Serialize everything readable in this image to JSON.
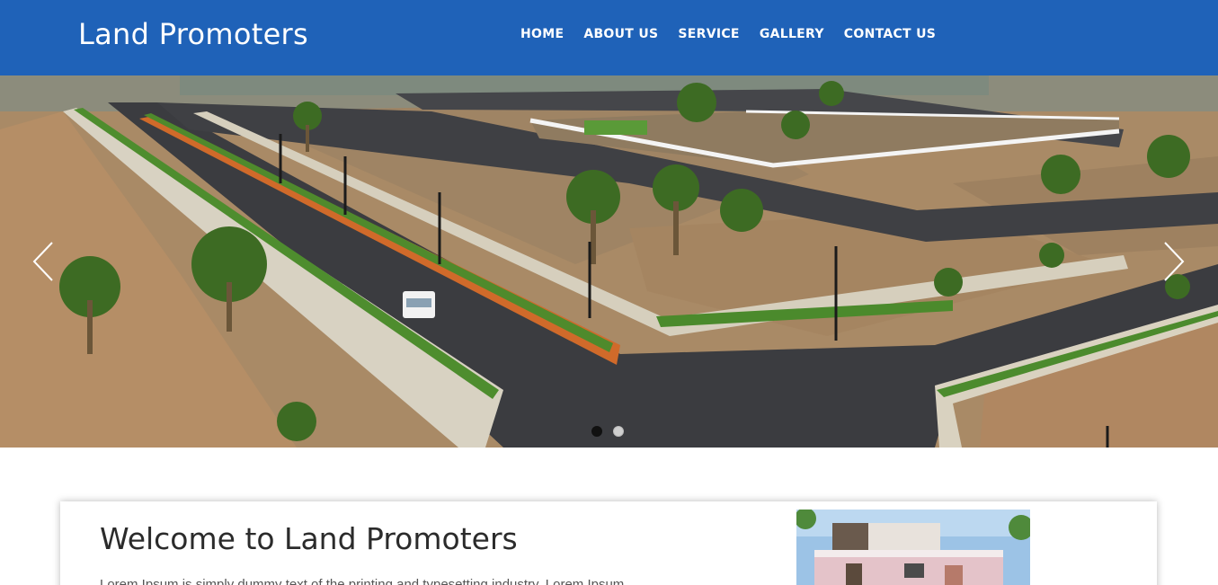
{
  "header": {
    "brand": "Land Promoters",
    "nav": [
      "HOME",
      "ABOUT US",
      "SERVICE",
      "GALLERY",
      "CONTACT US"
    ]
  },
  "slider": {
    "image": "aerial-view-of-land-plots",
    "slides": 2,
    "active_slide": 1,
    "prev_icon": "chevron-left-icon",
    "next_icon": "chevron-right-icon"
  },
  "welcome": {
    "title": "Welcome to Land Promoters",
    "text": "Lorem Ipsum is simply dummy text of the printing and typesetting industry. Lorem Ipsum",
    "image": "house-photo"
  },
  "colors": {
    "header_bg": "#1f62b8",
    "nav_text": "#ffffff",
    "title_text": "#2b2b2b"
  }
}
